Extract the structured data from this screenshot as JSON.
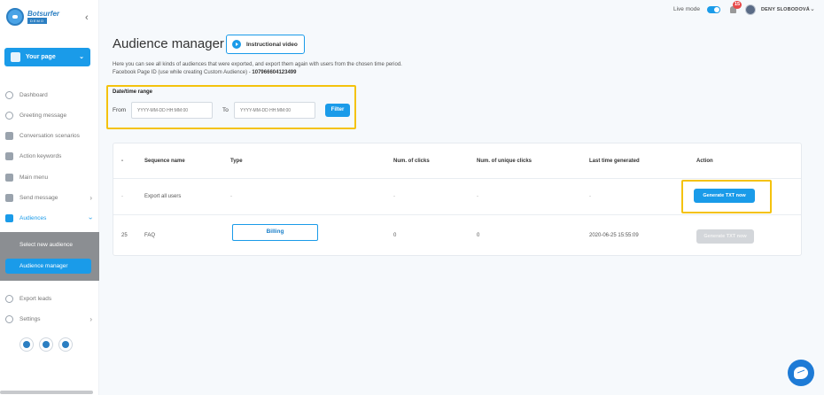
{
  "brand": {
    "name": "Botsurfer",
    "subtitle": "DEMO",
    "accent": "#1a9be9",
    "highlight": "#f4c20d"
  },
  "sidebar": {
    "page_selector": "Your page",
    "items": [
      {
        "label": "Dashboard",
        "icon": "dashboard-icon"
      },
      {
        "label": "Greeting message",
        "icon": "greeting-icon"
      },
      {
        "label": "Conversation scenarios",
        "icon": "folder-icon"
      },
      {
        "label": "Action keywords",
        "icon": "chat-icon"
      },
      {
        "label": "Main menu",
        "icon": "keyboard-icon"
      },
      {
        "label": "Send message",
        "icon": "send-icon"
      },
      {
        "label": "Audiences",
        "icon": "audience-icon"
      },
      {
        "label": "Export leads",
        "icon": "export-icon"
      },
      {
        "label": "Settings",
        "icon": "gear-icon"
      }
    ],
    "submenu": {
      "select_new": "Select new audience",
      "active": "Audience manager"
    }
  },
  "topbar": {
    "live_mode": "Live mode",
    "notifications": "15",
    "user": "DENY SLOBODOVÁ"
  },
  "main": {
    "title": "Audience manager",
    "video_button": "Instructional video",
    "description": "Here you can see all kinds of audiences that were exported, and export them again with users from the chosen time period.",
    "page_id_label": "Facebook Page ID (use while creating Custom Audience) -",
    "page_id": "107966604123499",
    "filter": {
      "title": "Date/time range",
      "from_label": "From",
      "to_label": "To",
      "placeholder": "YYYY-MM-DD HH:MM:00",
      "button": "Filter"
    },
    "table": {
      "headers": [
        "-",
        "Sequence name",
        "Type",
        "Num. of clicks",
        "Num. of unique clicks",
        "Last time generated",
        "Action"
      ],
      "rows": [
        {
          "id": "-",
          "name": "Export all users",
          "type": "-",
          "clicks": "-",
          "unique": "-",
          "last": "-",
          "action": "Generate TXT now"
        },
        {
          "id": "25",
          "name": "FAQ",
          "type": "Billing",
          "clicks": "0",
          "unique": "0",
          "last": "2020-06-25 15:55:09",
          "action": "Generate TXT now"
        }
      ]
    }
  }
}
